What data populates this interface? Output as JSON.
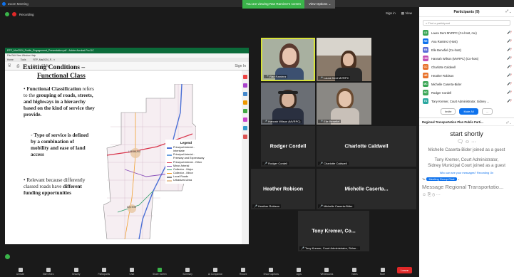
{
  "app": {
    "title": "Zoom Meeting",
    "recording": "Recording"
  },
  "share_banner": {
    "text": "You are viewing Rae Ramirez's screen",
    "view_options": "View Options"
  },
  "top_right": {
    "signin": "Sign in",
    "view": "View"
  },
  "pdf": {
    "window_title": "RTP_Mar2024_Public_Engagement_Presentation.pdf - Adobe Acrobat Pro DC",
    "menu": "File  Edit  View  Window  Help",
    "tabs": [
      "Home",
      "Tools",
      "RTP_Mar2024_P... ×"
    ],
    "zoom": "81%",
    "sign_in": "Sign In"
  },
  "slide": {
    "title_line1": "Existing Conditions –",
    "title_line2": "Functional Class",
    "bullets": [
      {
        "b": "Functional Classification",
        "t": " refers to the ",
        "b2": "grouping of roads, streets, and highways in a hierarchy based on the kind of service they provide."
      },
      {
        "b": "Type of service is defined by a combination of mobility and ease of land access"
      },
      {
        "t": "Relevant because differently classed roads have ",
        "b": "different funding opportunities"
      }
    ],
    "map_labels": [
      "LEESBURG",
      "DAYTON"
    ],
    "legend_title": "Legend",
    "legend": [
      {
        "label": "Principal Arterial - Interstate",
        "color": "#4a6fd6"
      },
      {
        "label": "Principal Arterial - Freeway and Expressway",
        "color": "#6aa0e0"
      },
      {
        "label": "Principal Arterial - Other",
        "color": "#d8334a"
      },
      {
        "label": "Minor Arterial",
        "color": "#8a4fb8"
      },
      {
        "label": "Collector - Major",
        "color": "#2e9e6a"
      },
      {
        "label": "Collector - Minor",
        "color": "#f0a030"
      },
      {
        "label": "Local Roads",
        "color": "#888888"
      },
      {
        "label": "Urbanized Area",
        "color": "#e8c6a0"
      }
    ]
  },
  "videos": [
    {
      "name": "Rae Ramirez",
      "type": "video"
    },
    {
      "name": "Laura Dent MVRPC",
      "type": "video"
    },
    {
      "name": "Hannah Wilson (MVRPC)",
      "type": "video"
    },
    {
      "name": "Elle Benefiel",
      "type": "video"
    },
    {
      "name": "Rodger Cordell",
      "type": "name"
    },
    {
      "name": "Charlotte Caldwell",
      "type": "name"
    },
    {
      "name": "Heather Robison",
      "type": "name"
    },
    {
      "name": "Michelle Caserta...",
      "full": "Michelle Caserta-Bider",
      "type": "name"
    },
    {
      "name": "Tony Kremer, Co...",
      "full": "Tony Kremer, Court Administrator, Sidne...",
      "type": "name"
    }
  ],
  "participants": {
    "title": "Participants (9)",
    "search_placeholder": "Find a participant",
    "list": [
      {
        "initials": "LD",
        "name": "Laura Dent MVRPC (Co-host, me)",
        "color": "#3aa655"
      },
      {
        "initials": "RR",
        "name": "Ana Ramirez (Host)",
        "color": "#0e72ed"
      },
      {
        "initials": "EB",
        "name": "Elle Benefiel (Co-host)",
        "color": "#5b6dd8"
      },
      {
        "initials": "HW",
        "name": "Hannah Wilson (MVRPC) (Co-host)",
        "color": "#c44fb5"
      },
      {
        "initials": "CC",
        "name": "Charlotte Caldwell",
        "color": "#e8722b"
      },
      {
        "initials": "HR",
        "name": "Heather Robison",
        "color": "#e8722b"
      },
      {
        "initials": "MC",
        "name": "Michelle Caserta-Bider",
        "color": "#3aa655"
      },
      {
        "initials": "RC",
        "name": "Rodger Cordell",
        "color": "#3aa655"
      },
      {
        "initials": "TK",
        "name": "Tony Kremer, Court Administrator, Sidney ...",
        "color": "#2aa8a0"
      }
    ],
    "invite": "Invite",
    "mute_all": "Mute All",
    "more": "..."
  },
  "chat": {
    "title": "Regional Transportation Plan Public Parti...",
    "start": "start shortly",
    "msg1": "Michelle Caserta-Bider joined as a guest",
    "msg2": "Tony Kremer, Court Administrator, Sidney Municipal Court joined as a guest",
    "who_sees": "Who can see your messages? Recording On",
    "to_label": "To:",
    "to_value": "Meeting Group Chat",
    "input_placeholder": "Message Regional Transportatio..."
  },
  "toolbar": {
    "items": [
      "Unmute",
      "Start Video",
      "Security",
      "Participants",
      "Chat",
      "Share Screen",
      "Summary",
      "AI Companion",
      "Record",
      "Show Captions",
      "Apps",
      "Whiteboards",
      "Notes",
      "More"
    ],
    "leave": "Leave"
  }
}
